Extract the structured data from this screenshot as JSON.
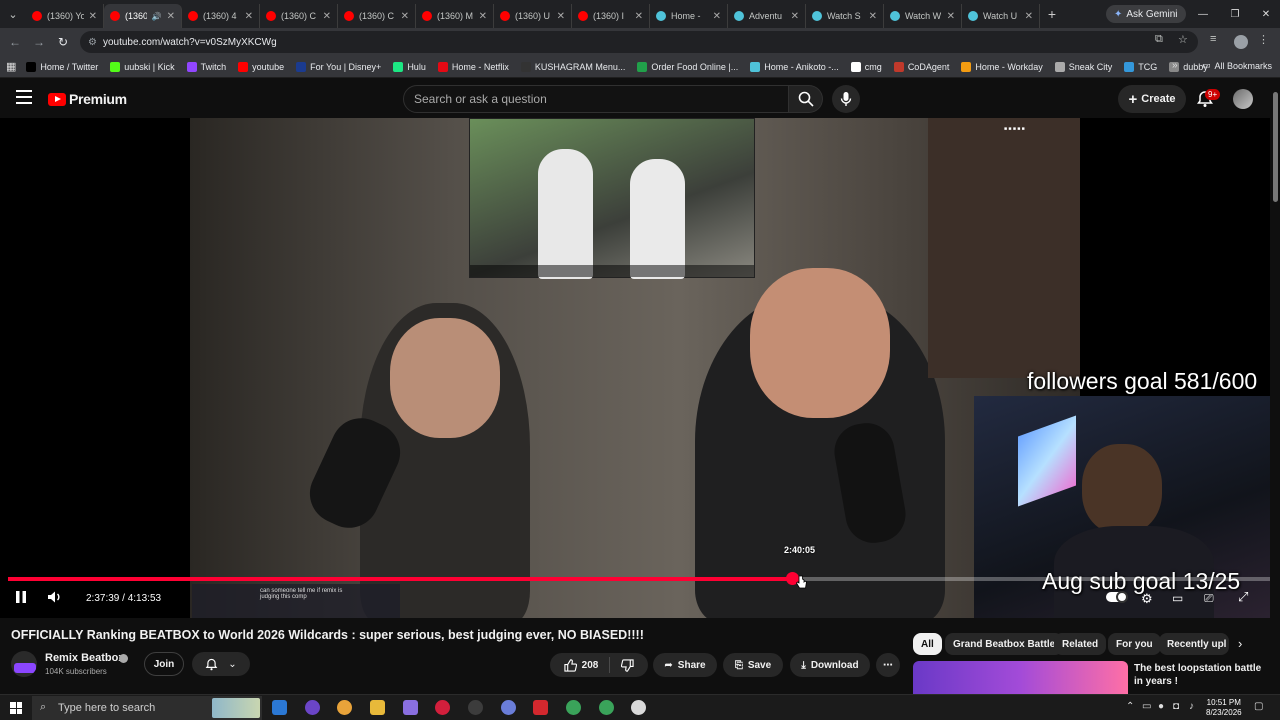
{
  "browser": {
    "tabs": [
      {
        "label": "(1360) Yo",
        "color": "#ff0000"
      },
      {
        "label": "(1360",
        "color": "#ff0000",
        "active": true
      },
      {
        "label": "(1360) 4",
        "color": "#ff0000"
      },
      {
        "label": "(1360) C",
        "color": "#ff0000"
      },
      {
        "label": "(1360) C",
        "color": "#ff0000"
      },
      {
        "label": "(1360) M",
        "color": "#ff0000"
      },
      {
        "label": "(1360) U",
        "color": "#ff0000"
      },
      {
        "label": "(1360) I",
        "color": "#ff0000"
      },
      {
        "label": "Home -",
        "color": "#4fc3d9"
      },
      {
        "label": "Adventu",
        "color": "#4fc3d9"
      },
      {
        "label": "Watch S",
        "color": "#4fc3d9"
      },
      {
        "label": "Watch W",
        "color": "#4fc3d9"
      },
      {
        "label": "Watch U",
        "color": "#4fc3d9"
      }
    ],
    "new_tab": "+",
    "ask_gemini": "Ask Gemini",
    "url": "youtube.com/watch?v=v0SzMyXKCWg",
    "bookmarks": [
      {
        "label": "Home / Twitter",
        "color": "#000000"
      },
      {
        "label": "uubski | Kick",
        "color": "#53fc18"
      },
      {
        "label": "Twitch",
        "color": "#9146ff"
      },
      {
        "label": "youtube",
        "color": "#ff0000"
      },
      {
        "label": "For You | Disney+",
        "color": "#1b3b8f"
      },
      {
        "label": "Hulu",
        "color": "#1ce783"
      },
      {
        "label": "Home - Netflix",
        "color": "#e50914"
      },
      {
        "label": "KUSHAGRAM Menu...",
        "color": "#333333"
      },
      {
        "label": "Order Food Online |...",
        "color": "#21a04a"
      },
      {
        "label": "Home - Anikoto -...",
        "color": "#4fc3d9"
      },
      {
        "label": "cmg",
        "color": "#ffffff"
      },
      {
        "label": "CoDAgent",
        "color": "#c0392b"
      },
      {
        "label": "Home - Workday",
        "color": "#f39c12"
      },
      {
        "label": "Sneak City",
        "color": "#aaaaaa"
      },
      {
        "label": "TCG",
        "color": "#3498db"
      },
      {
        "label": "dubby",
        "color": "#888888"
      }
    ],
    "all_bookmarks": "All Bookmarks"
  },
  "youtube": {
    "logo_text": "Premium",
    "search_placeholder": "Search or ask a question",
    "create_label": "Create",
    "notification_badge": "9+"
  },
  "video": {
    "overlay_followers": "followers goal 581/600",
    "overlay_subs": "Aug sub goal 13/25",
    "chat_line1": "can someone tell me if remix is",
    "chat_line2": "judging this comp",
    "hover_time": "2:40:05",
    "current_time": "2:37:39",
    "duration": "4:13:53",
    "time_display": "2:37:39 / 4:13:53",
    "progress_fraction": 0.621
  },
  "below": {
    "title": "OFFICIALLY Ranking BEATBOX to World 2026 Wildcards : super serious, best judging ever, NO BIASED!!!!",
    "channel": "Remix Beatbox",
    "subscribers": "104K subscribers",
    "join": "Join",
    "likes": "208",
    "share": "Share",
    "save": "Save",
    "download": "Download"
  },
  "chips": [
    "All",
    "Grand Beatbox Battle",
    "Related",
    "For you",
    "Recently upl"
  ],
  "recommendation": {
    "title": "The best loopstation battle in years !"
  },
  "taskbar": {
    "search_placeholder": "Type here to search",
    "time": "10:51 PM",
    "date": "8/23/2026"
  }
}
